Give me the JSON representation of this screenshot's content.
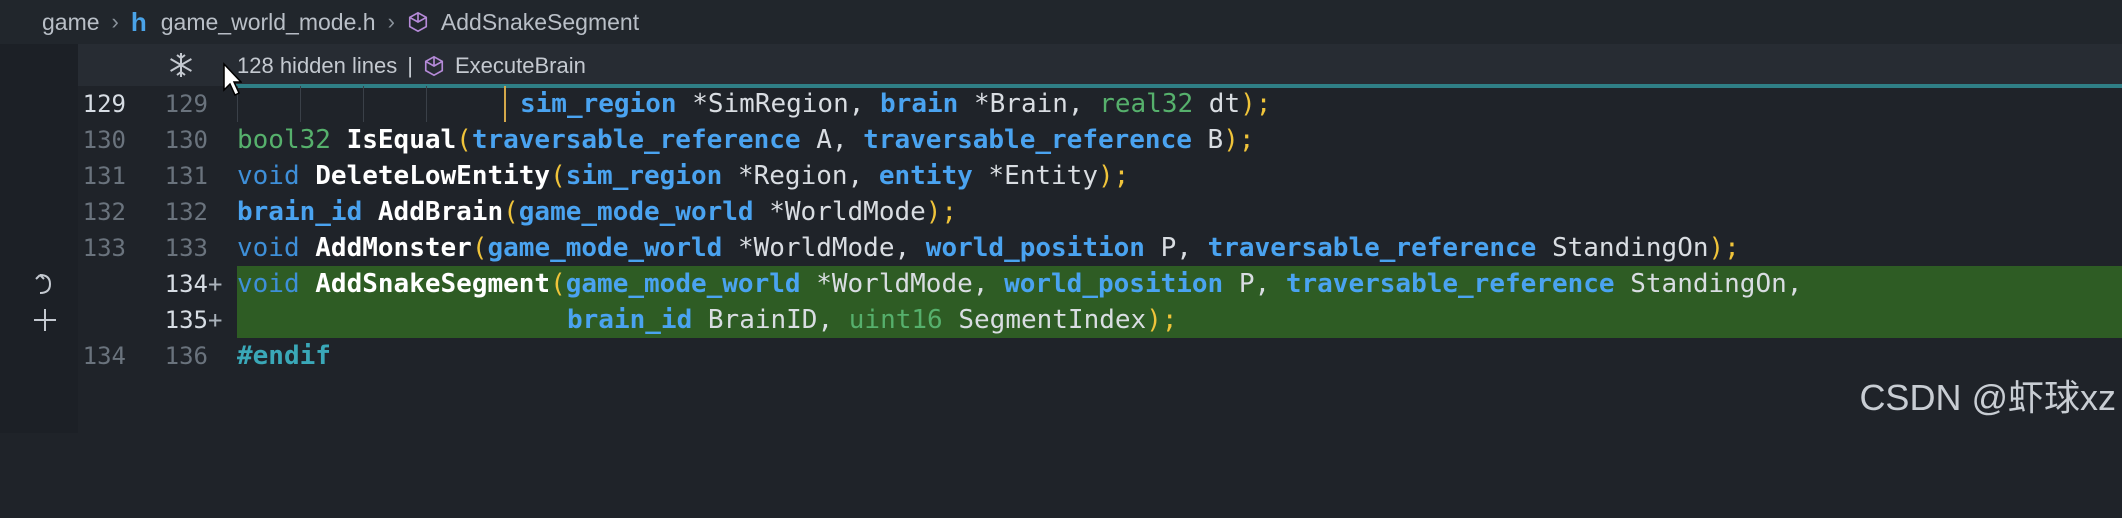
{
  "breadcrumb": {
    "folder": "game",
    "file": "game_world_mode.h",
    "file_icon": "h",
    "symbol": "AddSnakeSegment"
  },
  "sticky": {
    "hidden_lines": "128 hidden lines",
    "separator": "|",
    "symbol": "ExecuteBrain"
  },
  "lines": [
    {
      "old": "129",
      "new": "129"
    },
    {
      "old": "130",
      "new": "130"
    },
    {
      "old": "131",
      "new": "131"
    },
    {
      "old": "132",
      "new": "132"
    },
    {
      "old": "133",
      "new": "133"
    },
    {
      "old": "",
      "new": "134",
      "marker": "+"
    },
    {
      "old": "",
      "new": "135",
      "marker": "+"
    },
    {
      "old": "134",
      "new": "136"
    }
  ],
  "code": {
    "l1": {
      "t1": "sim_region",
      "t2": " *SimRegion, ",
      "t3": "brain",
      "t4": " *Brain, ",
      "t5": "real32",
      "t6": " dt",
      "t7": ");"
    },
    "l2": {
      "t1": "bool32",
      "t2": " ",
      "t3": "IsEqual",
      "t4": "(",
      "t5": "traversable_reference",
      "t6": " A, ",
      "t7": "traversable_reference",
      "t8": " B",
      "t9": ");"
    },
    "l3": {
      "t1": "void",
      "t2": " ",
      "t3": "DeleteLowEntity",
      "t4": "(",
      "t5": "sim_region",
      "t6": " *Region, ",
      "t7": "entity",
      "t8": " *Entity",
      "t9": ");"
    },
    "l4": {
      "t1": "brain_id",
      "t2": " ",
      "t3": "AddBrain",
      "t4": "(",
      "t5": "game_mode_world",
      "t6": " *WorldMode",
      "t7": ");"
    },
    "l5": {
      "t1": "void",
      "t2": " ",
      "t3": "AddMonster",
      "t4": "(",
      "t5": "game_mode_world",
      "t6": " *WorldMode, ",
      "t7": "world_position",
      "t8": " P, ",
      "t9": "traversable_reference",
      "t10": " StandingOn",
      "t11": ");"
    },
    "l6": {
      "t1": "void",
      "t2": " ",
      "t3": "AddSnakeSegment",
      "t4": "(",
      "t5": "game_mode_world",
      "t6": " *WorldMode, ",
      "t7": "world_position",
      "t8": " P, ",
      "t9": "traversable_reference",
      "t10": " StandingOn,"
    },
    "l7": {
      "t1": "brain_id",
      "t2": " BrainID, ",
      "t3": "uint16",
      "t4": " SegmentIndex",
      "t5": ");"
    },
    "l8": {
      "t1": "#endif"
    }
  },
  "watermark": "CSDN @虾球xz",
  "colors": {
    "background": "#1f2329",
    "added_line": "#2e5c24",
    "keyword": "#4aa3f0",
    "bracket": "#f0c43a"
  }
}
